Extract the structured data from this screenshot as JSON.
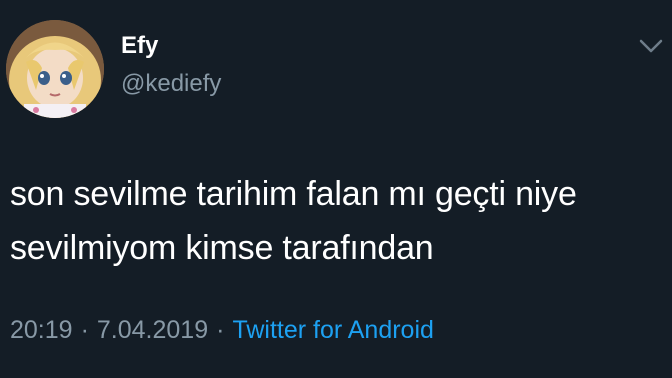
{
  "user": {
    "display_name": "Efy",
    "handle": "@kediefy"
  },
  "tweet": {
    "line1": "son sevilme tarihim falan mı geçti niye",
    "line2": "sevilmiyom kimse tarafından"
  },
  "meta": {
    "time": "20:19",
    "separator": "·",
    "date": "7.04.2019",
    "source": "Twitter for Android"
  },
  "icons": {
    "avatar": "anime-girl-avatar",
    "caret": "chevron-down-icon"
  },
  "colors": {
    "background": "#141d26",
    "text": "#ffffff",
    "muted": "#8899a6",
    "link": "#1da1f2"
  }
}
